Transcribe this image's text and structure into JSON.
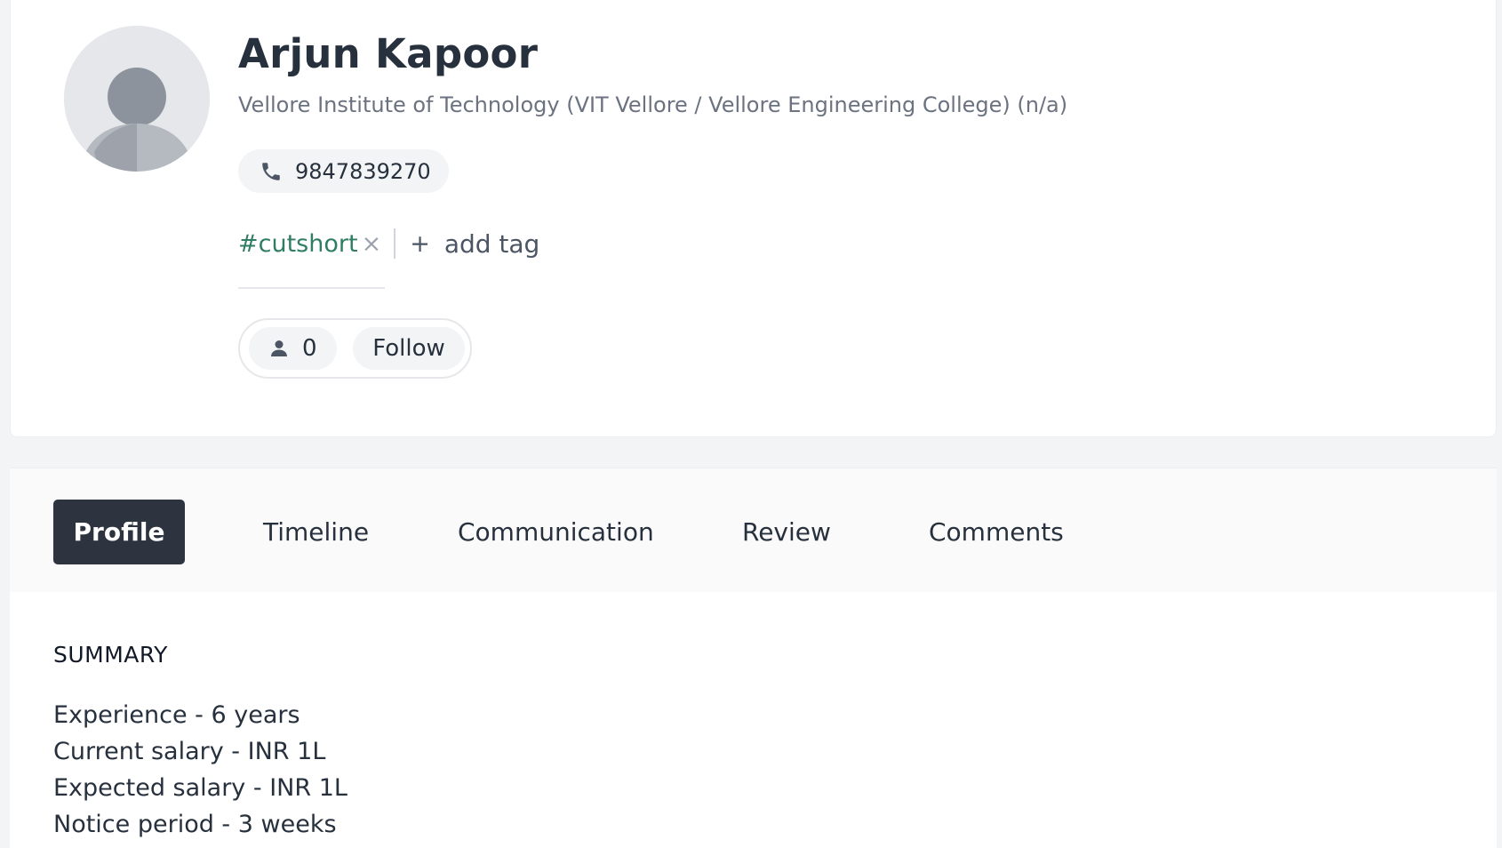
{
  "candidate": {
    "name": "Arjun Kapoor",
    "institution": "Vellore Institute of Technology (VIT Vellore / Vellore Engineering College) (n/a)",
    "phone": "9847839270"
  },
  "tags": {
    "items": [
      {
        "label": "#cutshort",
        "remove_glyph": "×"
      }
    ],
    "add_glyph": "+",
    "add_label": "add tag"
  },
  "social": {
    "followers": "0",
    "follow_label": "Follow"
  },
  "tabs": [
    {
      "label": "Profile",
      "active": true
    },
    {
      "label": "Timeline",
      "active": false
    },
    {
      "label": "Communication",
      "active": false
    },
    {
      "label": "Review",
      "active": false
    },
    {
      "label": "Comments",
      "active": false
    }
  ],
  "summary": {
    "heading": "SUMMARY",
    "lines": [
      "Experience - 6 years",
      "Current salary - INR 1L",
      "Expected salary - INR 1L",
      "Notice period - 3 weeks"
    ]
  },
  "icons": {
    "avatar": "user-avatar-placeholder",
    "phone": "phone-icon",
    "followers": "person-icon"
  },
  "colors": {
    "tag": "#2f7d62",
    "active_tab_bg": "#2d3440",
    "text": "#27303d",
    "muted": "#6b7280"
  }
}
